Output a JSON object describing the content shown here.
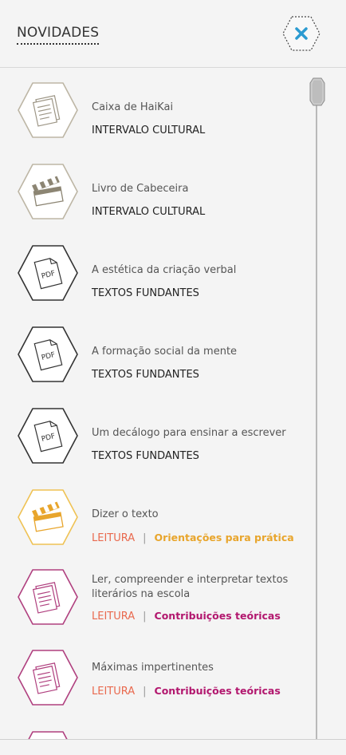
{
  "header": {
    "title": "NOVIDADES",
    "close_icon": "close-icon"
  },
  "colors": {
    "neutral": "#bdb6a5",
    "dark": "#333333",
    "yellow": "#efc254",
    "magenta": "#b0407f",
    "leitura": "#e9694e",
    "orient": "#e8a52c",
    "contrib": "#b2176e",
    "close": "#2b9bd1"
  },
  "items": [
    {
      "title": "Caixa de HaiKai",
      "category": "INTERVALO CULTURAL",
      "icon": "document-icon",
      "style": "neutral"
    },
    {
      "title": "Livro de Cabeceira",
      "category": "INTERVALO CULTURAL",
      "icon": "clapperboard-icon",
      "style": "neutral"
    },
    {
      "title": "A estética da criação verbal",
      "category": "TEXTOS FUNDANTES",
      "icon": "pdf-icon",
      "style": "dark"
    },
    {
      "title": "A formação social da mente",
      "category": "TEXTOS FUNDANTES",
      "icon": "pdf-icon",
      "style": "dark"
    },
    {
      "title": "Um decálogo para ensinar a escrever",
      "category": "TEXTOS FUNDANTES",
      "icon": "pdf-icon",
      "style": "dark"
    },
    {
      "title": "Dizer o texto",
      "category": "LEITURA",
      "subcategory": "Orientações para prática",
      "icon": "clapperboard-icon",
      "style": "yellow"
    },
    {
      "title": "Ler, compreender e interpretar textos literários na escola",
      "category": "LEITURA",
      "subcategory": "Contribuições teóricas",
      "icon": "document-icon",
      "style": "magenta"
    },
    {
      "title": "Máximas impertinentes",
      "category": "LEITURA",
      "subcategory": "Contribuições teóricas",
      "icon": "document-icon",
      "style": "magenta"
    }
  ]
}
